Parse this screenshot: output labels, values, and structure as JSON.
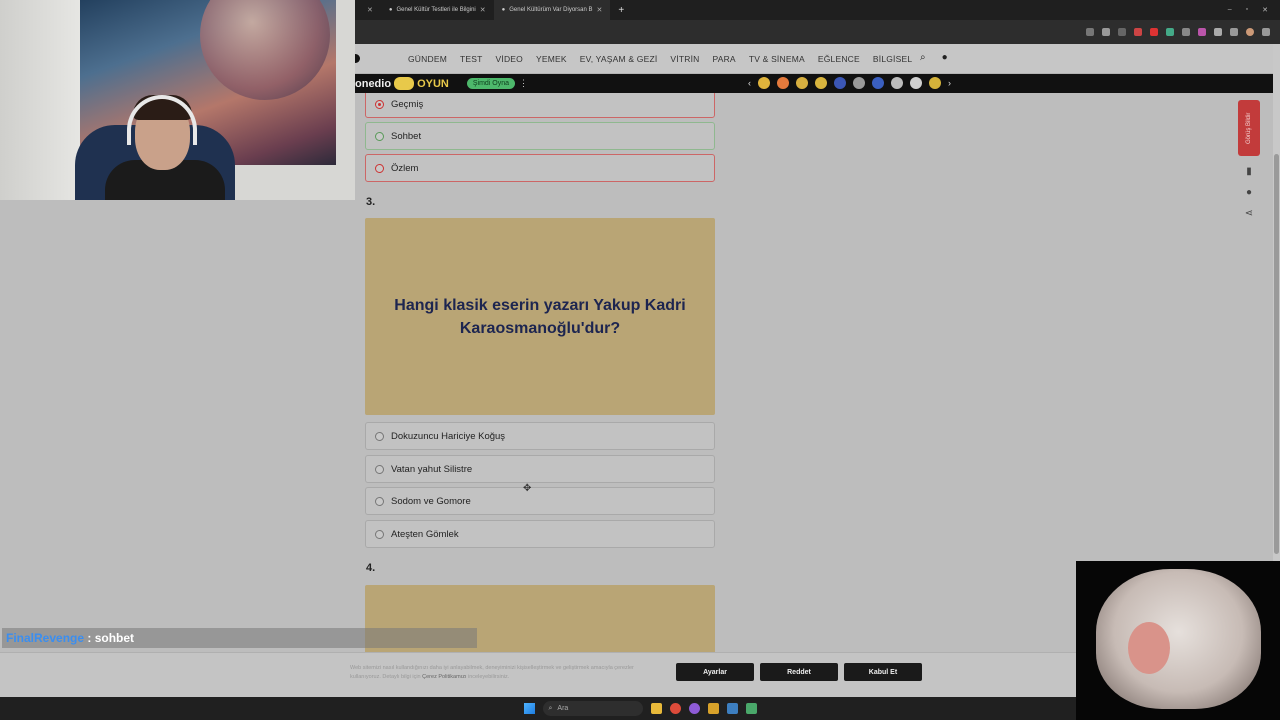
{
  "browser": {
    "tabs": [
      {
        "label": "",
        "active": false
      },
      {
        "label": "Genel Kültür Testleri ile Bilgini",
        "active": false
      },
      {
        "label": "Genel Kültürüm Var Diyorsan B",
        "active": true
      }
    ],
    "new_tab": "+",
    "window_controls": [
      "–",
      "▫",
      "✕"
    ]
  },
  "site": {
    "nav": [
      "GÜNDEM",
      "TEST",
      "VİDEO",
      "YEMEK",
      "EV, YAŞAM & GEZİ",
      "VİTRİN",
      "PARA",
      "TV & SİNEMA",
      "EĞLENCE",
      "BİLGİSEL"
    ],
    "gamebar": {
      "brand": "onedio",
      "label": "OYUN",
      "play": "Şimdi Oyna"
    }
  },
  "quiz": {
    "prev_options": [
      {
        "label": "Geçmiş",
        "state": "selected-wrong"
      },
      {
        "label": "Sohbet",
        "state": "correct"
      },
      {
        "label": "Özlem",
        "state": "wrong"
      }
    ],
    "q3": {
      "number": "3.",
      "question": "Hangi klasik eserin yazarı Yakup Kadri Karaosmanoğlu'dur?",
      "options": [
        "Dokuzuncu Hariciye Koğuş",
        "Vatan yahut Silistre",
        "Sodom ve Gomore",
        "Ateşten Gömlek"
      ]
    },
    "q4": {
      "number": "4."
    }
  },
  "sidetools": {
    "feedback": "Görüş Bildir"
  },
  "cookie": {
    "text": "Web sitemizi nasıl kullandığınızı daha iyi anlayabilmek, deneyiminizi kişiselleştirmek ve geliştirmek amacıyla çerezler kullanıyoruz. Detaylı bilgi için",
    "link": "Çerez Politikamızı",
    "text_end": "inceleyebilirsiniz.",
    "buttons": [
      "Ayarlar",
      "Reddet",
      "Kabul Et"
    ]
  },
  "taskbar": {
    "search_placeholder": "Ara"
  },
  "chat": {
    "user": "FinalRevenge",
    "separator": " : ",
    "message": "sohbet"
  },
  "colors": {
    "card": "#b9a575",
    "question_text": "#1d2550",
    "feedback": "#c23b3b"
  }
}
